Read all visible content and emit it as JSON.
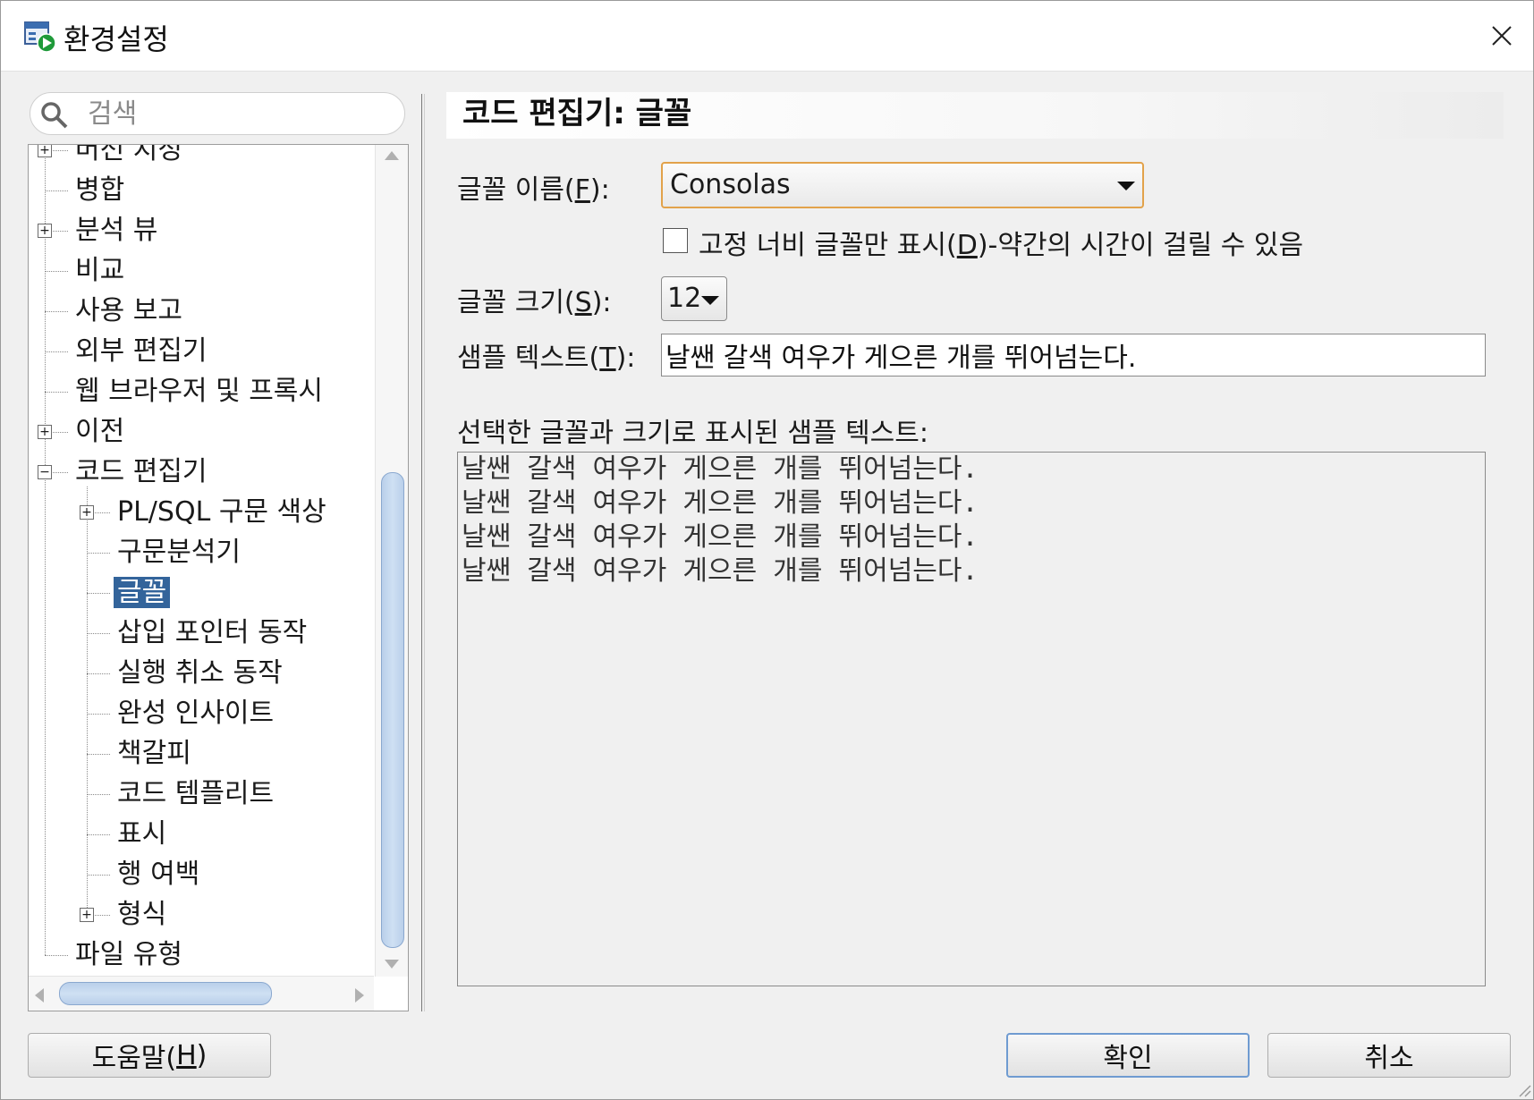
{
  "window": {
    "title": "환경설정"
  },
  "search": {
    "placeholder": "검색"
  },
  "tree": {
    "items": [
      {
        "label": "버전 지정",
        "level": 0,
        "expander": "plus"
      },
      {
        "label": "병합",
        "level": 0,
        "expander": "none"
      },
      {
        "label": "분석 뷰",
        "level": 0,
        "expander": "plus"
      },
      {
        "label": "비교",
        "level": 0,
        "expander": "none"
      },
      {
        "label": "사용 보고",
        "level": 0,
        "expander": "none"
      },
      {
        "label": "외부 편집기",
        "level": 0,
        "expander": "none"
      },
      {
        "label": "웹 브라우저 및 프록시",
        "level": 0,
        "expander": "none"
      },
      {
        "label": "이전",
        "level": 0,
        "expander": "plus"
      },
      {
        "label": "코드 편집기",
        "level": 0,
        "expander": "minus"
      },
      {
        "label": "PL/SQL 구문 색상",
        "level": 1,
        "expander": "plus"
      },
      {
        "label": "구문분석기",
        "level": 1,
        "expander": "none"
      },
      {
        "label": "글꼴",
        "level": 1,
        "expander": "none",
        "selected": true
      },
      {
        "label": "삽입 포인터 동작",
        "level": 1,
        "expander": "none"
      },
      {
        "label": "실행 취소 동작",
        "level": 1,
        "expander": "none"
      },
      {
        "label": "완성 인사이트",
        "level": 1,
        "expander": "none"
      },
      {
        "label": "책갈피",
        "level": 1,
        "expander": "none"
      },
      {
        "label": "코드 템플리트",
        "level": 1,
        "expander": "none"
      },
      {
        "label": "표시",
        "level": 1,
        "expander": "none"
      },
      {
        "label": "행 여백",
        "level": 1,
        "expander": "none"
      },
      {
        "label": "형식",
        "level": 1,
        "expander": "plus"
      },
      {
        "label": "파일 유형",
        "level": 0,
        "expander": "none"
      }
    ]
  },
  "panel": {
    "title": "코드 편집기: 글꼴",
    "font_name": {
      "label_pre": "글꼴 이름(",
      "mnemonic": "F",
      "label_post": "):",
      "value": "Consolas"
    },
    "fixed_width": {
      "label_pre": "고정 너비 글꼴만 표시(",
      "mnemonic": "D",
      "label_post": ")-약간의 시간이 걸릴 수 있음",
      "checked": false
    },
    "font_size": {
      "label_pre": "글꼴 크기(",
      "mnemonic": "S",
      "label_post": "):",
      "value": "12"
    },
    "sample_text": {
      "label_pre": "샘플 텍스트(",
      "mnemonic": "T",
      "label_post": "):",
      "value": "날쌘 갈색 여우가 게으른 개를 뛰어넘는다."
    },
    "preview": {
      "label": "선택한 글꼴과 크기로 표시된 샘플 텍스트:",
      "lines": [
        "날쌘 갈색 여우가 게으른 개를 뛰어넘는다.",
        "날쌘 갈색 여우가 게으른 개를 뛰어넘는다.",
        "날쌘 갈색 여우가 게으른 개를 뛰어넘는다.",
        "날쌘 갈색 여우가 게으른 개를 뛰어넘는다."
      ]
    }
  },
  "buttons": {
    "help": {
      "label_pre": "도움말(",
      "mnemonic": "H",
      "label_post": ")"
    },
    "ok": "확인",
    "cancel": "취소"
  },
  "colors": {
    "selection": "#33649b",
    "focus_border": "#e2a24a",
    "scroll_thumb": "#b9cfea"
  }
}
